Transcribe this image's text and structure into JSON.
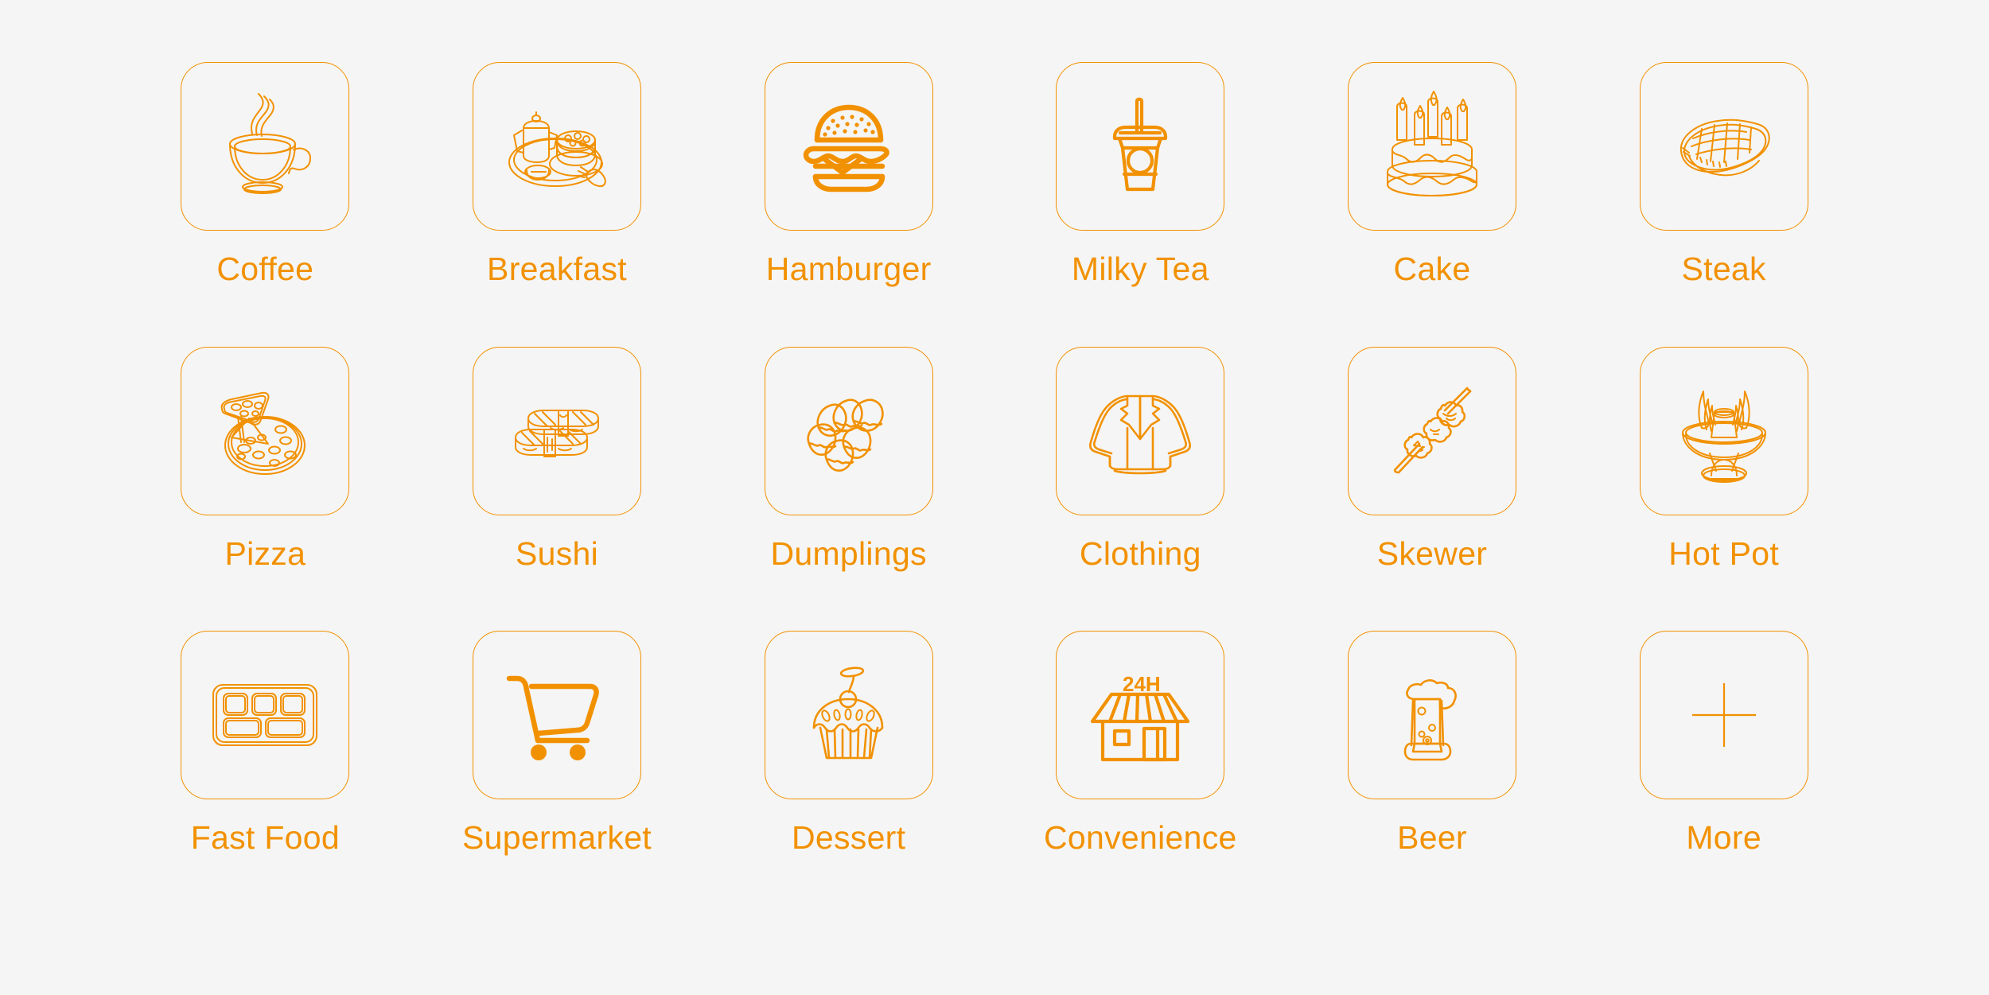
{
  "theme": {
    "background_color": "#f5f5f5",
    "accent_color": "#F29100",
    "card_border_color": "#F29100",
    "label_color": "#F29100"
  },
  "grid": {
    "columns": 6,
    "rows": 3,
    "total_items": 18
  },
  "categories": [
    {
      "label": "Coffee",
      "icon": "coffee-cup-icon"
    },
    {
      "label": "Breakfast",
      "icon": "breakfast-tray-icon"
    },
    {
      "label": "Hamburger",
      "icon": "hamburger-icon"
    },
    {
      "label": "Milky Tea",
      "icon": "milky-tea-cup-icon"
    },
    {
      "label": "Cake",
      "icon": "birthday-cake-icon"
    },
    {
      "label": "Steak",
      "icon": "steak-icon"
    },
    {
      "label": "Pizza",
      "icon": "pizza-icon"
    },
    {
      "label": "Sushi",
      "icon": "sushi-icon"
    },
    {
      "label": "Dumplings",
      "icon": "dumplings-icon"
    },
    {
      "label": "Clothing",
      "icon": "clothing-shirt-icon"
    },
    {
      "label": "Skewer",
      "icon": "skewer-icon"
    },
    {
      "label": "Hot Pot",
      "icon": "hot-pot-icon"
    },
    {
      "label": "Fast Food",
      "icon": "bento-tray-icon"
    },
    {
      "label": "Supermarket",
      "icon": "shopping-cart-icon"
    },
    {
      "label": "Dessert",
      "icon": "cupcake-icon"
    },
    {
      "label": "Convenience",
      "icon": "convenience-store-icon"
    },
    {
      "label": "Beer",
      "icon": "beer-glass-icon"
    },
    {
      "label": "More",
      "icon": "plus-icon"
    }
  ],
  "convenience_store": {
    "sign_text": "24H"
  }
}
